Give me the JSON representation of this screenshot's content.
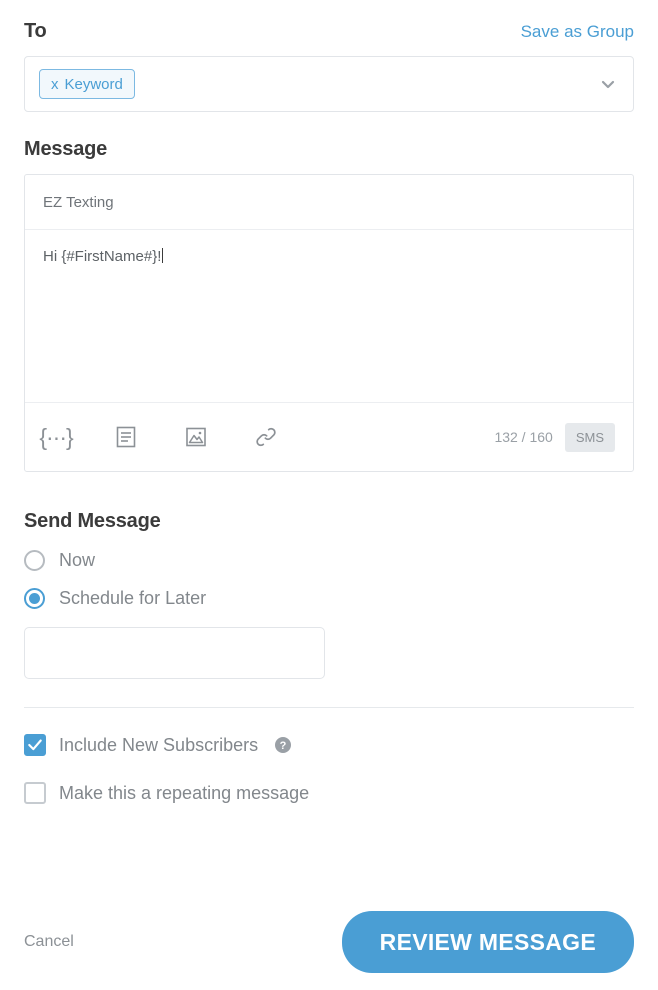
{
  "to": {
    "label": "To",
    "save_as_group": "Save as Group",
    "chip": {
      "remove": "x",
      "text": "Keyword"
    },
    "dropdown_icon": "chevron-down-icon"
  },
  "message": {
    "label": "Message",
    "subject_value": "EZ Texting",
    "body_value": "Hi {#FirstName#}!",
    "toolbar": {
      "merge_field_icon": "{···}",
      "template_icon": "template-icon",
      "image_icon": "image-icon",
      "link_icon": "link-icon",
      "char_count": "132 / 160",
      "type_badge": "SMS"
    }
  },
  "send": {
    "label": "Send Message",
    "options": [
      {
        "label": "Now",
        "selected": false
      },
      {
        "label": "Schedule for Later",
        "selected": true
      }
    ],
    "schedule_value": ""
  },
  "checkboxes": [
    {
      "label": "Include New Subscribers",
      "checked": true,
      "help": "?"
    },
    {
      "label": "Make this a repeating message",
      "checked": false
    }
  ],
  "footer": {
    "cancel": "Cancel",
    "review": "REVIEW MESSAGE"
  },
  "colors": {
    "accent": "#4a9ed4",
    "border": "#e2e5e9",
    "text_muted": "#82878c",
    "heading": "#3b3b3b"
  }
}
